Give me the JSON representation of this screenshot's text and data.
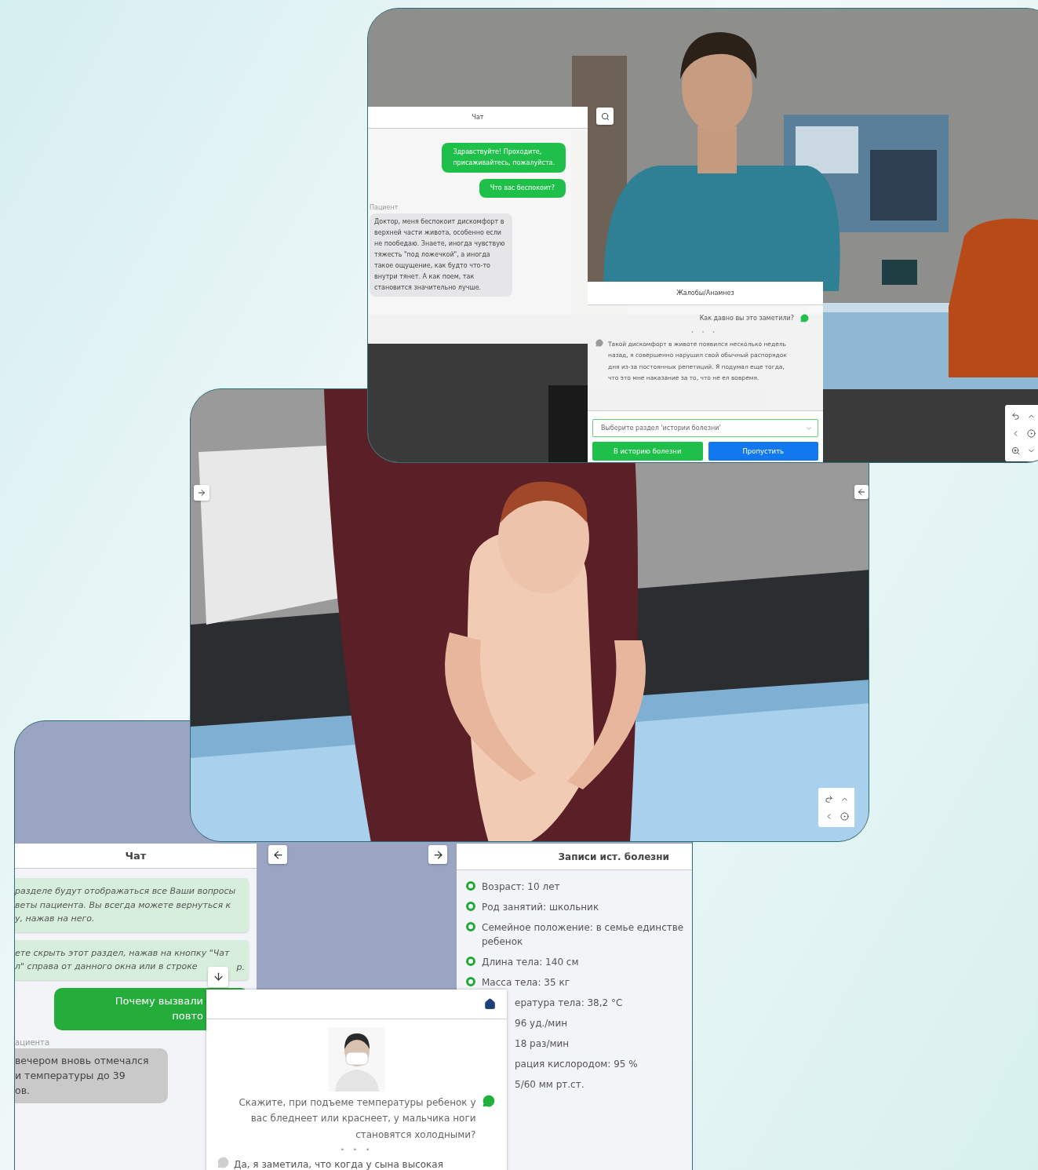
{
  "top_screen": {
    "chat": {
      "title": "Чат",
      "messages": [
        {
          "kind": "doctor",
          "text": "Здравствуйте! Проходите,\nприсаживайтесь, пожалуйста."
        },
        {
          "kind": "doctor",
          "text": "Что вас беспокоит?"
        },
        {
          "kind": "patient",
          "sender": "Пациент",
          "text": "Доктор, меня беспокоит дискомфорт в верхней части живота, особенно если не пообедаю. Знаете, иногда чувствую тяжесть \"под ложечкой\", а иногда такое ощущение, как будто что-то внутри тянет. А как поем, так становится значительно лучше."
        }
      ]
    },
    "dialog": {
      "title": "Жалобы/Анамнез",
      "question": "Как давно вы это заметили?",
      "typing": "• • •",
      "answer": "Такой дискомфорт в животе появился несколько недель назад, я совершенно нарушил свой обычный распорядок дня из-за постоянных репетиций. Я подумал еще тогда, что это мне наказание за то, что не ел вовремя.",
      "select_placeholder": "Выберите раздел 'истории болезни'",
      "buttons": [
        {
          "kind": "primary",
          "label": "В историю болезни"
        },
        {
          "kind": "secondary",
          "label": "Пропустить"
        }
      ]
    }
  },
  "bottom_screen": {
    "chat": {
      "title": "Чат",
      "messages": [
        {
          "kind": "info",
          "text": "разделе будут отображаться все Ваши вопросы\nветы пациента. Вы всегда можете вернуться к\nу, нажав на него."
        },
        {
          "kind": "info",
          "text": "ете скрыть этот раздел, нажав на кнопку \"Чат\nл\" справа от данного окна или в строке",
          "tail": "р."
        },
        {
          "kind": "doctor",
          "text": "Почему вызвали\nповто"
        },
        {
          "kind": "patient",
          "sender": "ациента",
          "text": "вечером вновь отмечался\nи температуры до 39\nов."
        }
      ]
    },
    "records": {
      "title": "Записи ист. болезни",
      "items": [
        {
          "kind": "full",
          "text": "Возраст: 10 лет"
        },
        {
          "kind": "full",
          "text": "Род занятий: школьник"
        },
        {
          "kind": "full",
          "text": "Семейное положение: в семье единстве\nребенок"
        },
        {
          "kind": "full",
          "text": "Длина тела: 140 см"
        },
        {
          "kind": "full",
          "text": "Масса тела: 35 кг"
        },
        {
          "kind": "covered",
          "text": "ература тела: 38,2 °C"
        },
        {
          "kind": "covered",
          "text": "96 уд./мин"
        },
        {
          "kind": "covered",
          "text": "18 раз/мин"
        },
        {
          "kind": "covered",
          "text": "рация кислородом: 95 %"
        },
        {
          "kind": "covered",
          "text": "5/60 мм рт.ст."
        }
      ]
    },
    "dialog": {
      "question": "Скажите, при подъеме температуры ребенок у вас бледнеет или краснеет, у мальчика ноги становятся холодными?",
      "typing": "• • •",
      "answer": "Да, я заметила, что когда у сына высокая"
    }
  }
}
